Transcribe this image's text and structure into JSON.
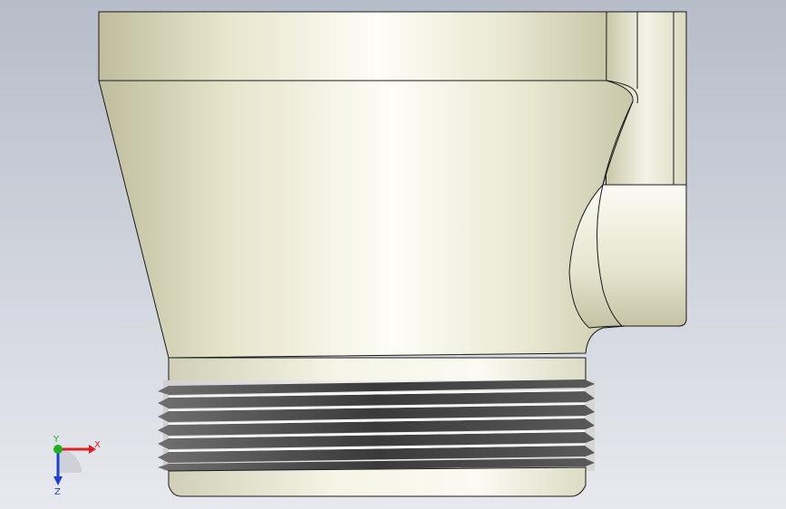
{
  "viewport": {
    "background_top": "#b7bdc9",
    "background_bottom": "#e6e8ee",
    "part_color": "#e9e7d2",
    "edge_color": "#1a1a1a"
  },
  "triad": {
    "x_label": "X",
    "y_label": "Y",
    "z_label": "Z",
    "x_color": "#e02020",
    "y_color": "#20b020",
    "z_color": "#2040d0"
  }
}
